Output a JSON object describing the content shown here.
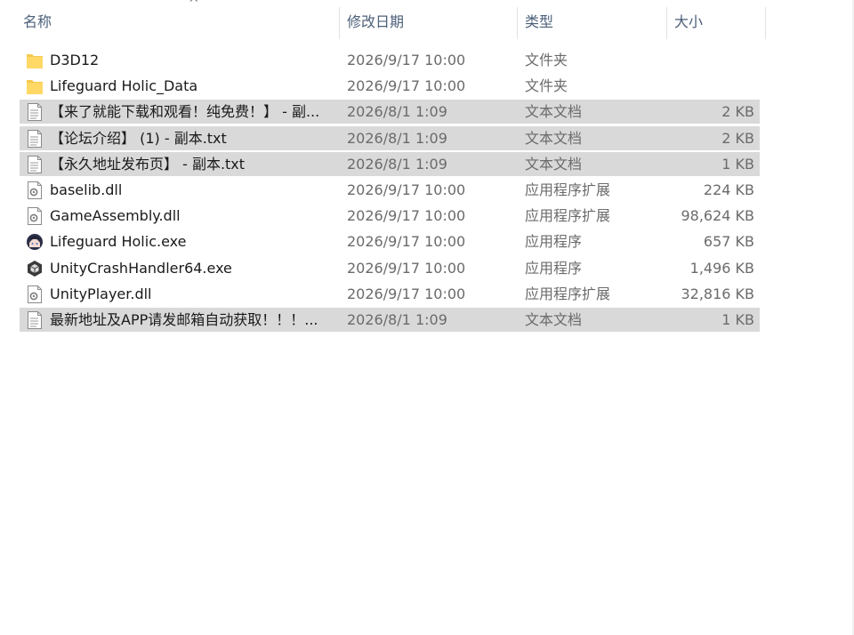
{
  "columns": {
    "name": "名称",
    "date": "修改日期",
    "type": "类型",
    "size": "大小",
    "sort_indicator": "^"
  },
  "files": [
    {
      "name": "D3D12",
      "date": "2026/9/17 10:00",
      "type": "文件夹",
      "size": "",
      "icon": "folder-icon",
      "selected": false
    },
    {
      "name": "Lifeguard Holic_Data",
      "date": "2026/9/17 10:00",
      "type": "文件夹",
      "size": "",
      "icon": "folder-icon",
      "selected": false
    },
    {
      "name": "【来了就能下载和观看！纯免费！】 - 副...",
      "date": "2026/8/1 1:09",
      "type": "文本文档",
      "size": "2 KB",
      "icon": "text-file-icon",
      "selected": true
    },
    {
      "name": "【论坛介绍】 (1) - 副本.txt",
      "date": "2026/8/1 1:09",
      "type": "文本文档",
      "size": "2 KB",
      "icon": "text-file-icon",
      "selected": true
    },
    {
      "name": "【永久地址发布页】  - 副本.txt",
      "date": "2026/8/1 1:09",
      "type": "文本文档",
      "size": "1 KB",
      "icon": "text-file-icon",
      "selected": true
    },
    {
      "name": "baselib.dll",
      "date": "2026/9/17 10:00",
      "type": "应用程序扩展",
      "size": "224 KB",
      "icon": "dll-file-icon",
      "selected": false
    },
    {
      "name": "GameAssembly.dll",
      "date": "2026/9/17 10:00",
      "type": "应用程序扩展",
      "size": "98,624 KB",
      "icon": "dll-file-icon",
      "selected": false
    },
    {
      "name": "Lifeguard Holic.exe",
      "date": "2026/9/17 10:00",
      "type": "应用程序",
      "size": "657 KB",
      "icon": "game-app-icon",
      "selected": false
    },
    {
      "name": "UnityCrashHandler64.exe",
      "date": "2026/9/17 10:00",
      "type": "应用程序",
      "size": "1,496 KB",
      "icon": "unity-app-icon",
      "selected": false
    },
    {
      "name": "UnityPlayer.dll",
      "date": "2026/9/17 10:00",
      "type": "应用程序扩展",
      "size": "32,816 KB",
      "icon": "dll-file-icon",
      "selected": false
    },
    {
      "name": "最新地址及APP请发邮箱自动获取！！！...",
      "date": "2026/8/1 1:09",
      "type": "文本文档",
      "size": "1 KB",
      "icon": "text-file-icon",
      "selected": true
    }
  ],
  "colors": {
    "selection": "#d9d9d9",
    "header_text": "#4c607a",
    "folder": "#f6c94e",
    "secondary_text": "#6b6b6b"
  }
}
